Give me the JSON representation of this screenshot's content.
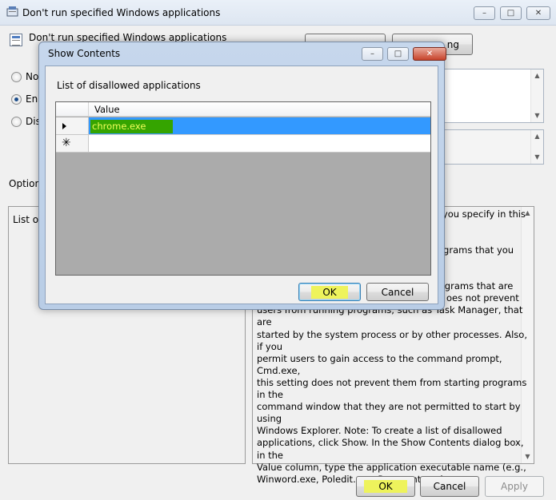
{
  "main_window": {
    "title": "Don't run specified Windows applications",
    "policy_title": "Don't run specified Windows applications",
    "caption_buttons": {
      "minimize": "–",
      "maximize": "□",
      "close": "✕"
    },
    "top_button_right_visible_label": "ng",
    "radios": [
      {
        "label": "No",
        "checked": false
      },
      {
        "label": "Ena",
        "checked": true
      },
      {
        "label": "Dis",
        "checked": false
      }
    ],
    "options_label": "Option",
    "options_panel_label": "List of",
    "help_lines": [
      "s you specify in this",
      "",
      "ograms that you",
      "",
      "programs that are",
      "oes not prevent",
      "users from running programs, such as Task Manager, that are",
      "started by the system process or by other processes.  Also, if you",
      "permit users to gain access to the command prompt, Cmd.exe,",
      "this setting does not prevent them from starting programs in the",
      "command window that they are not permitted to start by using",
      "Windows Explorer. Note: To create a list of disallowed",
      "applications, click Show. In the Show Contents dialog box, in the",
      "Value column, type the application executable name (e.g.,",
      "Winword.exe, Poledit.exe, Powerpnt.exe)."
    ],
    "footer": {
      "ok_label": "OK",
      "cancel_label": "Cancel",
      "apply_label": "Apply"
    }
  },
  "dialog": {
    "title": "Show Contents",
    "list_label": "List of disallowed applications",
    "grid": {
      "column_header": "Value",
      "rows": [
        {
          "value": "chrome.exe",
          "selected": true
        }
      ],
      "new_row_marker": "✳"
    },
    "ok_label": "OK",
    "cancel_label": "Cancel"
  },
  "colors": {
    "highlight": "#eef35c",
    "selection": "#3399ff",
    "marker_green": "#35a400"
  },
  "icons": [
    "app-icon",
    "policy-icon",
    "minimize-icon",
    "maximize-icon",
    "close-icon",
    "row-arrow-icon",
    "new-row-icon",
    "scroll-up-icon",
    "scroll-down-icon"
  ]
}
